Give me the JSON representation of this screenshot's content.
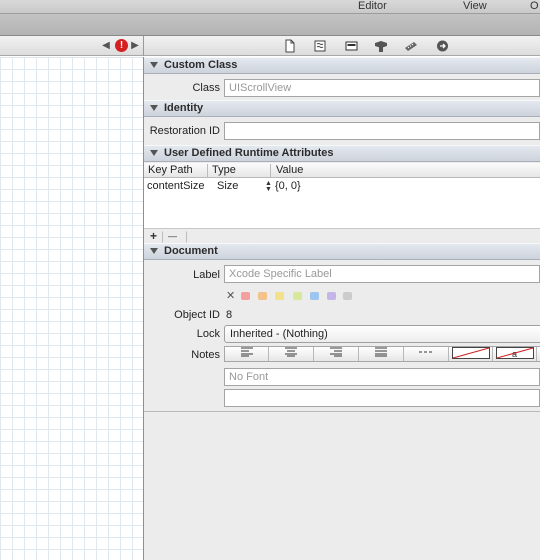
{
  "menubar": {
    "items": [
      "Editor",
      "View",
      "O"
    ]
  },
  "jumpbar": {
    "prev_glyph": "◀",
    "next_glyph": "▶",
    "warning_glyph": "!"
  },
  "inspector_tabs": [
    {
      "name": "file-inspector-icon",
      "glyph": "🗋"
    },
    {
      "name": "quick-help-icon",
      "glyph": "≋"
    },
    {
      "name": "identity-inspector-icon",
      "glyph": "▤"
    },
    {
      "name": "attributes-inspector-icon",
      "glyph": "⛊"
    },
    {
      "name": "size-inspector-icon",
      "glyph": "📏"
    },
    {
      "name": "connections-inspector-icon",
      "glyph": "➲"
    }
  ],
  "custom_class": {
    "title": "Custom Class",
    "class_label": "Class",
    "class_placeholder": "UIScrollView"
  },
  "identity": {
    "title": "Identity",
    "restoration_label": "Restoration ID",
    "restoration_value": ""
  },
  "runtime_attributes": {
    "title": "User Defined Runtime Attributes",
    "columns": [
      "Key Path",
      "Type",
      "Value"
    ],
    "rows": [
      {
        "key_path": "contentSize",
        "type": "Size",
        "value": "{0, 0}"
      }
    ],
    "add_label": "+",
    "remove_label": "—"
  },
  "document": {
    "title": "Document",
    "label_label": "Label",
    "label_placeholder": "Xcode Specific Label",
    "clear_color_glyph": "✕",
    "label_colors": [
      "#f2a0a0",
      "#f5c28a",
      "#f3e08a",
      "#d6e89a",
      "#9cc5ef",
      "#c6b6e8",
      "#cccccc"
    ],
    "object_id_label": "Object ID",
    "object_id_value": "8",
    "lock_label": "Lock",
    "lock_value": "Inherited - (Nothing)",
    "notes_label": "Notes",
    "notes_font_placeholder": "No Font",
    "notes_text": ""
  }
}
